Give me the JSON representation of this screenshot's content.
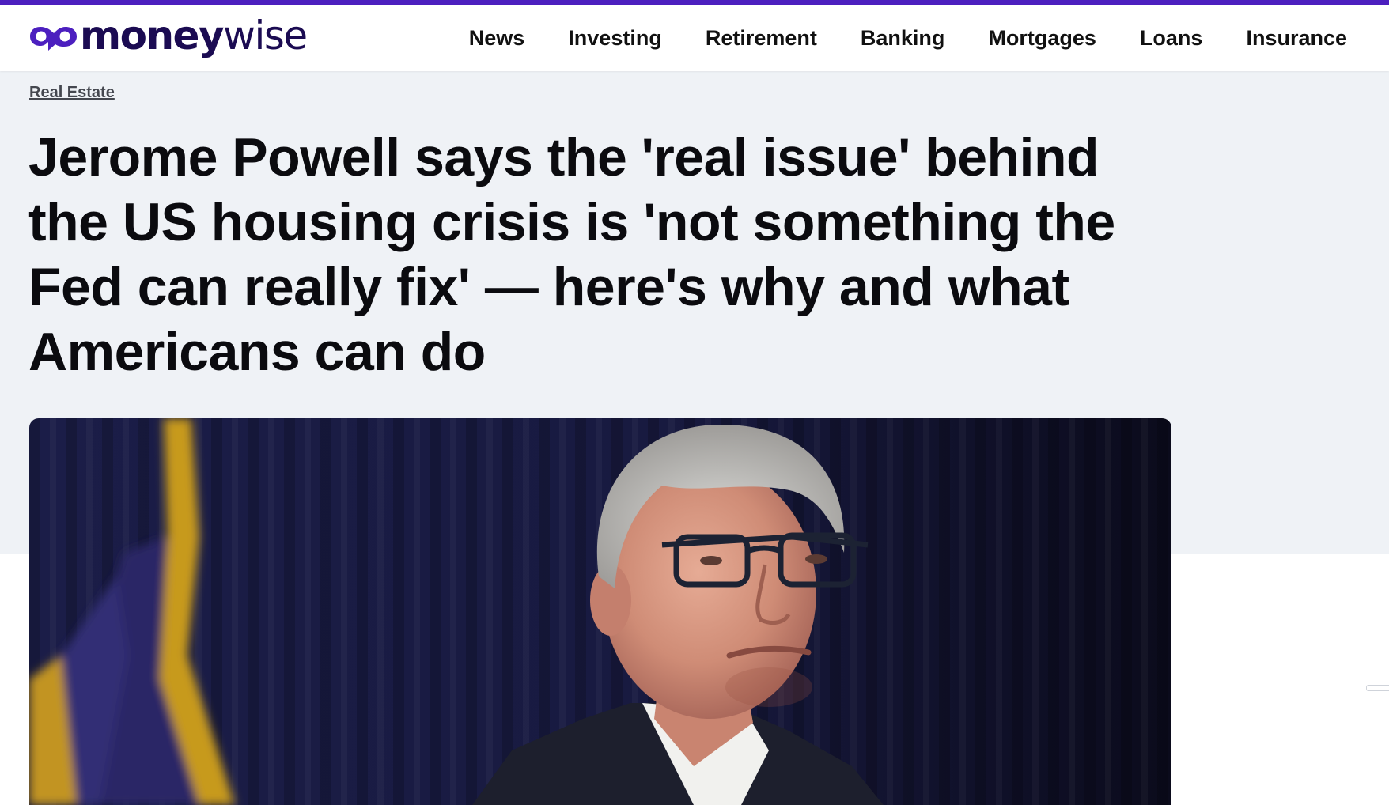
{
  "brand": {
    "name_bold": "money",
    "name_light": "wise",
    "accent": "#4c1fbf",
    "logo_color": "#1b0b52"
  },
  "nav": {
    "items": [
      {
        "label": "News"
      },
      {
        "label": "Investing"
      },
      {
        "label": "Retirement"
      },
      {
        "label": "Banking"
      },
      {
        "label": "Mortgages"
      },
      {
        "label": "Loans"
      },
      {
        "label": "Insurance"
      }
    ]
  },
  "article": {
    "category": "Real Estate",
    "headline": "Jerome Powell says the 'real issue' behind the US housing crisis is 'not something the Fed can really fix' — here's why and what Americans can do"
  },
  "colors": {
    "hero_background": "#eff2f6",
    "page_background": "#ffffff",
    "text": "#0b0b0f"
  }
}
